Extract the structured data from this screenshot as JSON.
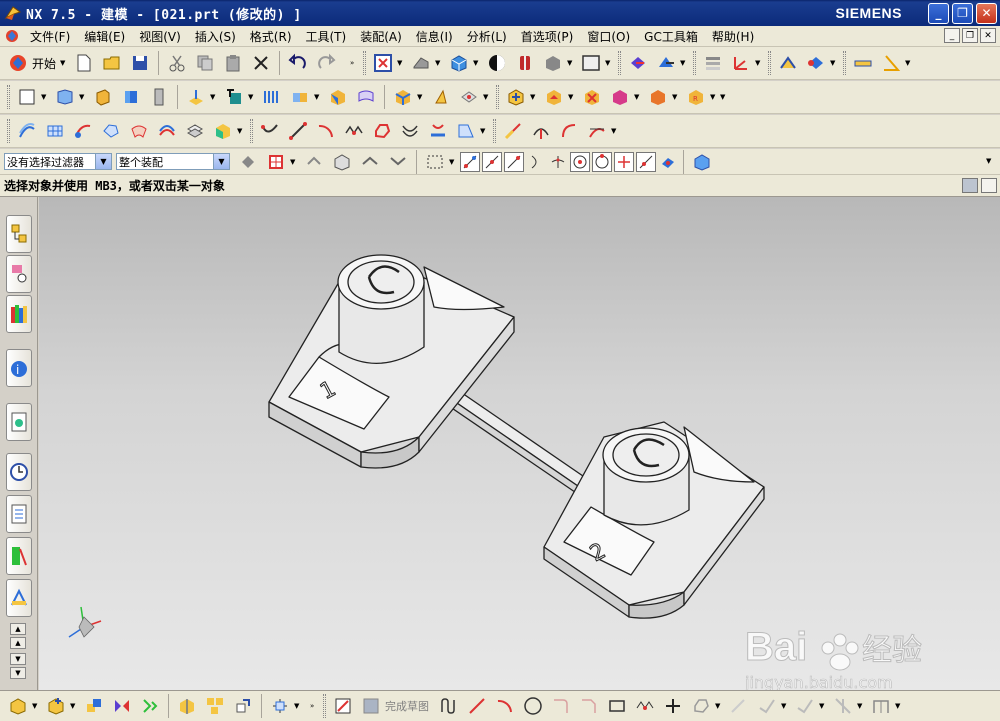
{
  "window": {
    "title": "NX 7.5 - 建模 - [021.prt  (修改的) ]",
    "brand": "SIEMENS",
    "minimize": "_",
    "restore": "❐",
    "close": "✕"
  },
  "menu": {
    "items": [
      "文件(F)",
      "编辑(E)",
      "视图(V)",
      "插入(S)",
      "格式(R)",
      "工具(T)",
      "装配(A)",
      "信息(I)",
      "分析(L)",
      "首选项(P)",
      "窗口(O)",
      "GC工具箱",
      "帮助(H)"
    ]
  },
  "toolbar": {
    "start_label": "开始",
    "more": "»"
  },
  "selection": {
    "filter_value": "没有选择过滤器",
    "scope_value": "整个装配"
  },
  "cue": {
    "text": "选择对象并使用 MB3，或者双击某一对象"
  },
  "model": {
    "label_left": "1",
    "label_right": "2"
  },
  "bottom": {
    "finish_sketch_label": "完成草图"
  },
  "watermark": {
    "brand": "Bai",
    "brand_cn": "经验",
    "url": "jingyan.baidu.com"
  },
  "colors": {
    "titlebar": "#0a246a",
    "toolbar_bg": "#ece9d8",
    "viewport_top": "#b8b8b8",
    "viewport_bottom": "#e8e8e8",
    "part_face": "#f2f2f2",
    "part_edge": "#222222"
  }
}
